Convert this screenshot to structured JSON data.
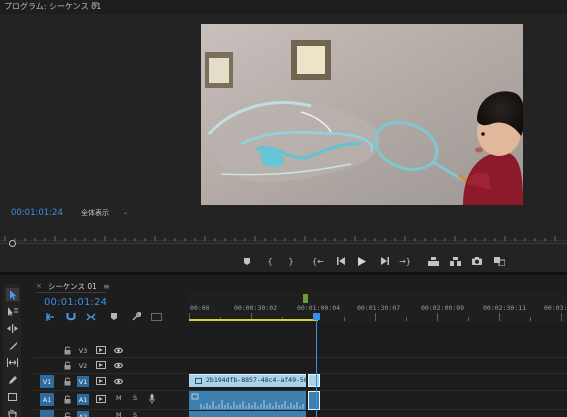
{
  "monitor": {
    "title": "プログラム: シーケンス 01",
    "timecode": "00:01:01:24",
    "zoom": "全体表示"
  },
  "timeline": {
    "tab_label": "シーケンス 01",
    "timecode": "00:01:01:24",
    "ruler_labels": [
      "00:00",
      "00:00:30:02",
      "00:01:00:04",
      "00:01:30:07",
      "00:02:00:09",
      "00:02:30:11",
      "00:03:0"
    ],
    "tracks": {
      "v3": "V3",
      "v2": "V2",
      "v1": "V1",
      "a1": "A1",
      "a2": "A2",
      "src_v1": "V1",
      "src_a1": "A1",
      "mute": "M",
      "solo": "S"
    },
    "clip_name": "2b194dfb-8857-48c4-af49-56e7"
  },
  "icons": {
    "menu": "hamburger-menu-icon",
    "close": "close-icon"
  },
  "colors": {
    "accent": "#3a8fe6",
    "video_clip": "#a8d3ea",
    "audio_clip": "#3d7fae",
    "track_target": "#2e6b9e",
    "in_out": "#d7cf3a"
  }
}
